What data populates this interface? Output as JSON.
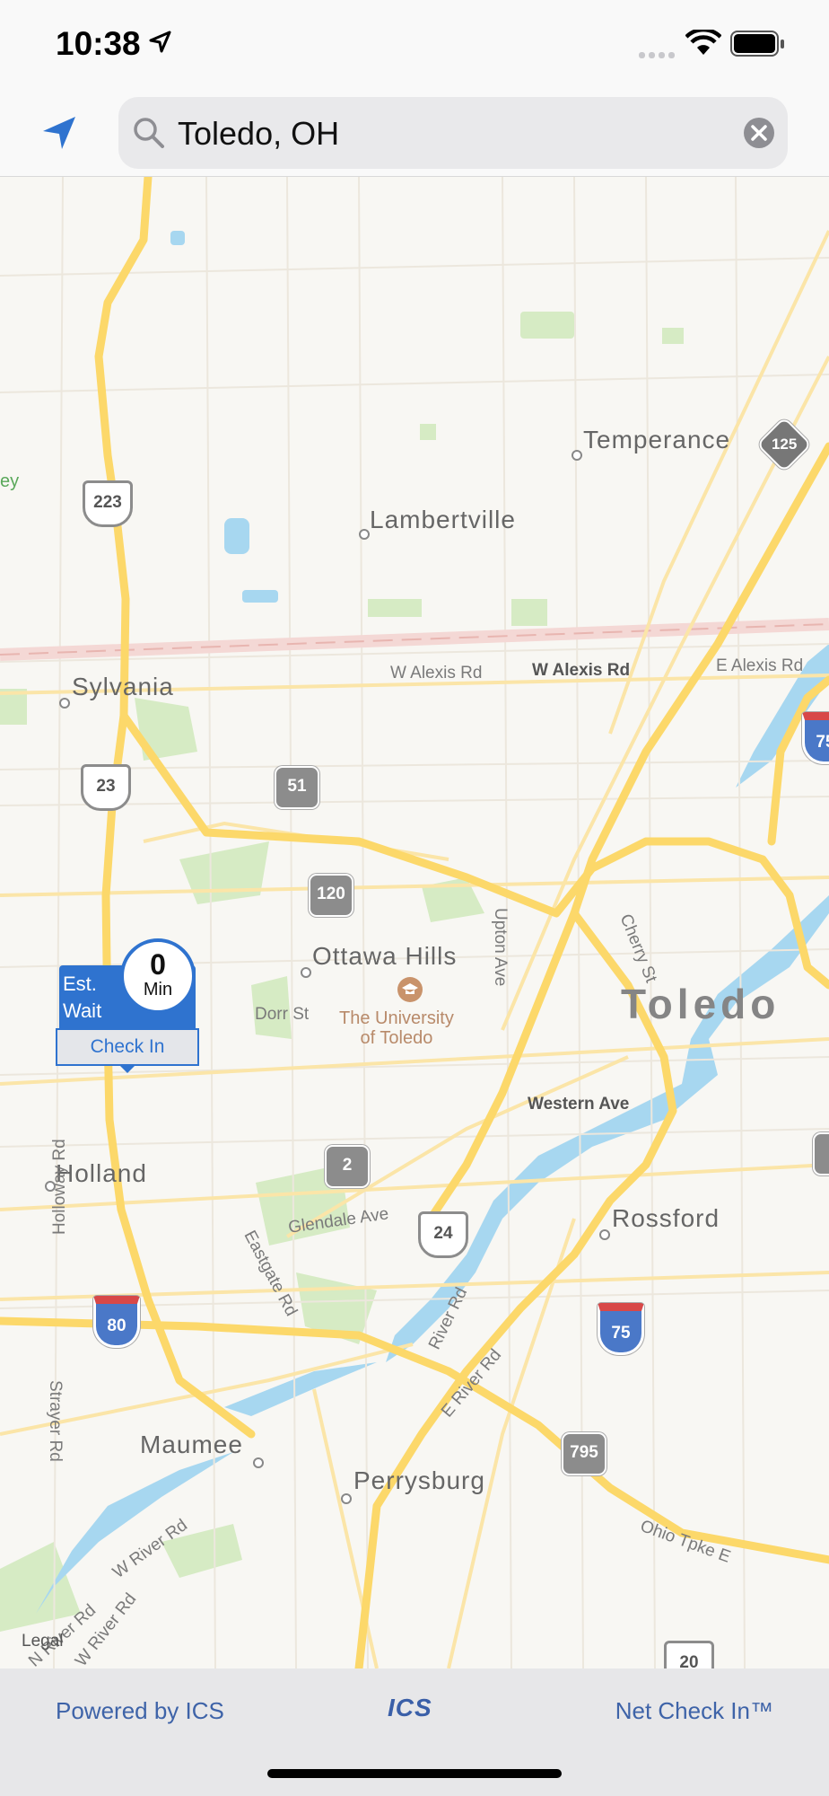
{
  "status_bar": {
    "time": "10:38"
  },
  "search": {
    "query": "Toledo, OH"
  },
  "callout": {
    "est_label_1": "Est.",
    "est_label_2": "Wait",
    "wait_value": "0",
    "wait_unit": "Min",
    "checkin_label": "Check In"
  },
  "map": {
    "cities": {
      "temperance": "Temperance",
      "lambertville": "Lambertville",
      "sylvania": "Sylvania",
      "ottawa_hills": "Ottawa Hills",
      "toledo": "Toledo",
      "holland": "Holland",
      "rossford": "Rossford",
      "maumee": "Maumee",
      "perrysburg": "Perrysburg"
    },
    "roads": {
      "w_alexis_1": "W Alexis Rd",
      "w_alexis_2": "W Alexis Rd",
      "e_alexis": "E Alexis Rd",
      "cherry_st": "Cherry St",
      "upton_ave": "Upton Ave",
      "dorr_st": "Dorr St",
      "western_ave": "Western Ave",
      "glendale_ave": "Glendale Ave",
      "eastgate_rd": "Eastgate Rd",
      "holloway_rd": "Holloway Rd",
      "strayer_rd": "Strayer Rd",
      "river_rd": "River Rd",
      "e_river_rd": "E River Rd",
      "w_river_rd": "W River Rd",
      "w_river_rd_2": "W River Rd",
      "ohio_tpke": "Ohio Tpke E",
      "n_river_rd": "N River Rd"
    },
    "poi": {
      "university_1": "The University",
      "university_2": "of Toledo"
    },
    "edge_label": "ey",
    "legal": "Legal",
    "shields": {
      "us_223": "223",
      "us_23": "23",
      "oh_51": "51",
      "oh_120": "120",
      "oh_2": "2",
      "us_24": "24",
      "i_80": "80",
      "i_75": "75",
      "i_75_edge": "75",
      "oh_795": "795",
      "us_20": "20",
      "m_125": "125"
    }
  },
  "footer": {
    "left": "Powered by ICS",
    "logo": "ICS",
    "right": "Net Check In™"
  },
  "colors": {
    "accent_blue": "#2f73cf",
    "map_bg": "#f8f7f3",
    "highway": "#fcd86a",
    "water": "#a7d7f0",
    "park": "#d6ebc4"
  }
}
